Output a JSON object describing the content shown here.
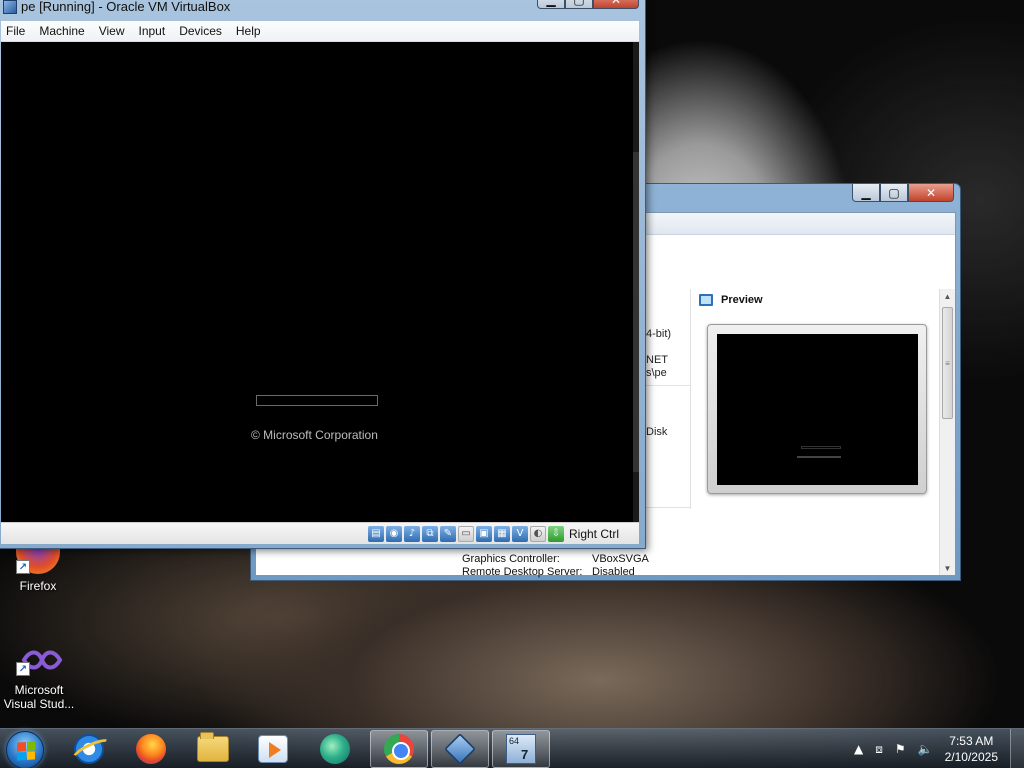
{
  "vm_window": {
    "title": "pe [Running] - Oracle VM VirtualBox",
    "menu": [
      "File",
      "Machine",
      "View",
      "Input",
      "Devices",
      "Help"
    ],
    "screen_text": "© Microsoft Corporation",
    "host_key": "Right Ctrl",
    "status_icons": [
      "hard-disk-icon",
      "optical-drive-icon",
      "audio-icon",
      "network-icon",
      "usb-icon",
      "shared-folders-icon",
      "display-icon",
      "recording-icon",
      "cpu-icon",
      "mouse-integration-icon",
      "host-key-icon"
    ]
  },
  "manager_window": {
    "preview_title": "Preview",
    "fragments": [
      "4-bit)",
      "NET",
      "s\\pe",
      "Disk"
    ],
    "details": [
      {
        "key": "Graphics Controller:",
        "value": "VBoxSVGA"
      },
      {
        "key": "Remote Desktop Server:",
        "value": "Disabled"
      }
    ]
  },
  "desktop": {
    "icons": [
      {
        "label": "Firefox"
      },
      {
        "label": "Microsoft Visual Stud..."
      }
    ]
  },
  "taskbar": {
    "apps": [
      "internet-explorer-icon",
      "firefox-icon",
      "file-explorer-icon",
      "media-player-icon",
      "app-icon",
      "chrome-icon",
      "virtualbox-icon",
      "directx-icon"
    ],
    "time": "7:53 AM",
    "date": "2/10/2025"
  }
}
